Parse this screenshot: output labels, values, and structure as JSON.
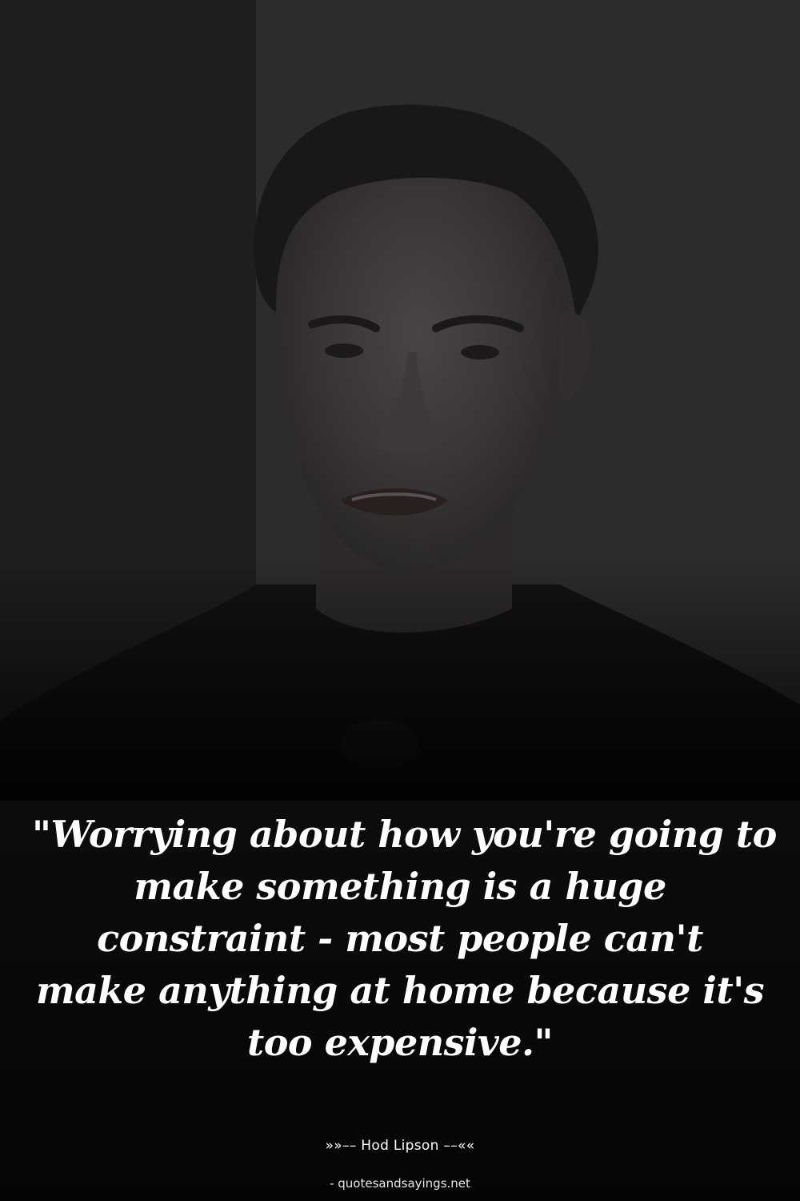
{
  "quote": {
    "lines": [
      "\"Worrying about how you're going to",
      "make something is a huge",
      "constraint - most people can't",
      "make anything at home because it's",
      "too expensive.\""
    ]
  },
  "attribution": "»»–– Hod Lipson ––««",
  "source": "- quotesandsayings.net",
  "colors": {
    "background": "#000000",
    "text": "#ffffff"
  }
}
